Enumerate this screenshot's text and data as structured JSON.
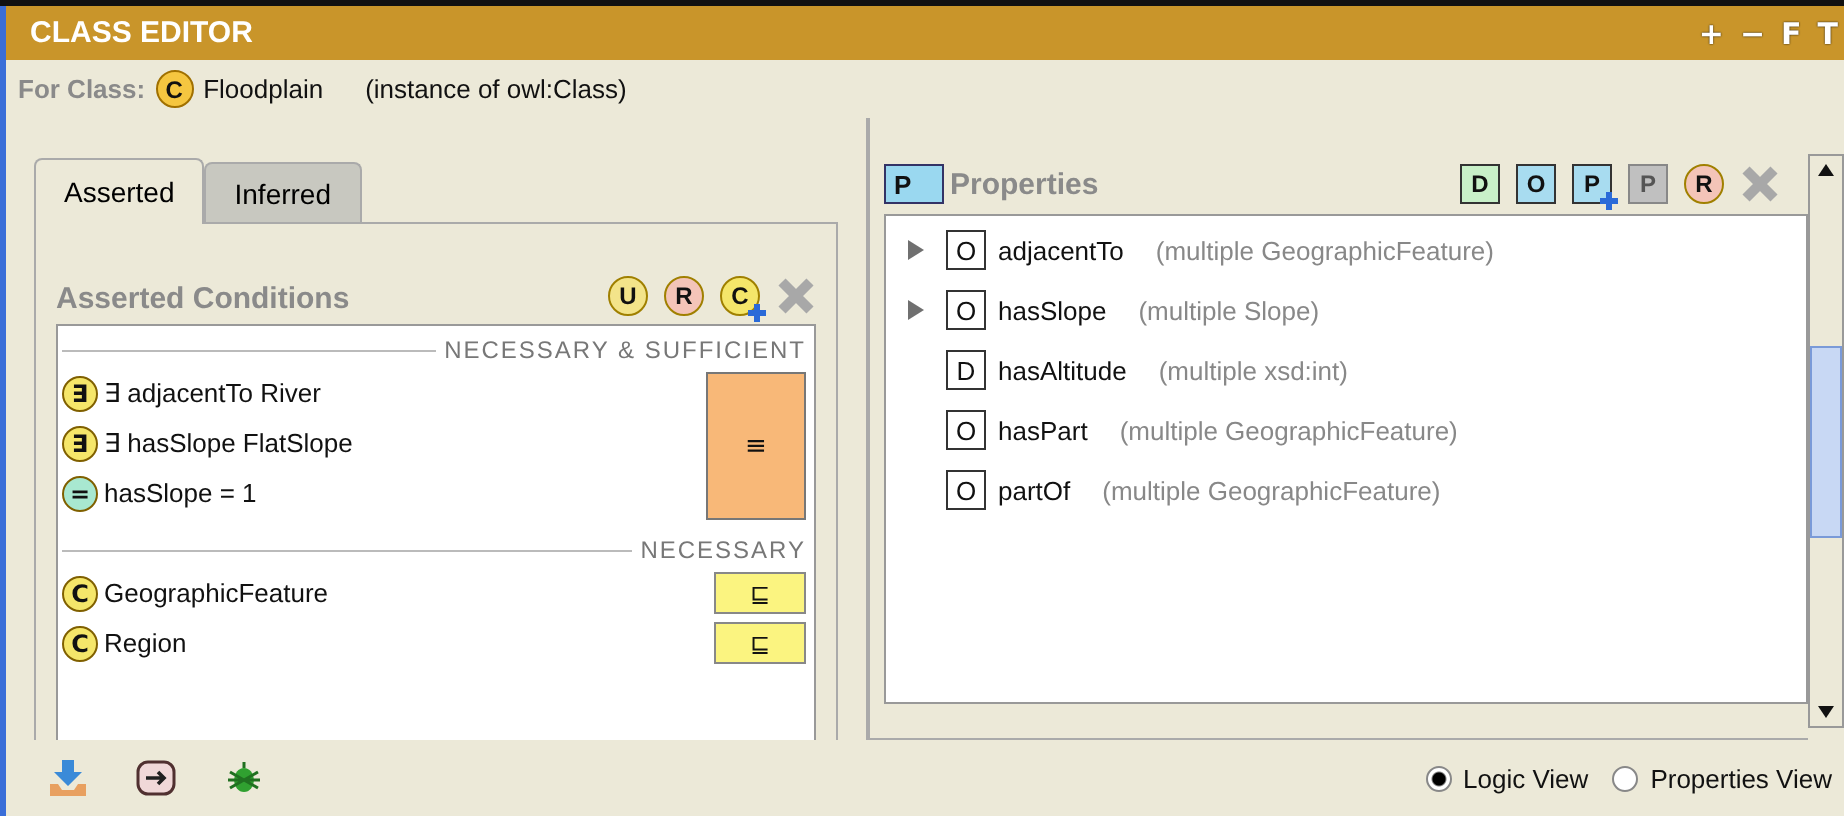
{
  "window": {
    "title": "CLASS EDITOR",
    "title_buttons": [
      "+",
      "−",
      "F",
      "T"
    ]
  },
  "for_class": {
    "label": "For Class:",
    "icon_glyph": "C",
    "name": "Floodplain",
    "type": "(instance of owl:Class)"
  },
  "tabs": [
    {
      "label": "Asserted",
      "selected": true
    },
    {
      "label": "Inferred",
      "selected": false
    }
  ],
  "conditions": {
    "title": "Asserted Conditions",
    "toolbar": [
      {
        "kind": "circle",
        "glyph": "U",
        "color": "#f3e48a",
        "disabled": false,
        "plus": false
      },
      {
        "kind": "circle",
        "glyph": "R",
        "color": "#f4c4b8",
        "disabled": false,
        "plus": false
      },
      {
        "kind": "circle",
        "glyph": "C",
        "color": "#f5e66a",
        "disabled": false,
        "plus": true
      },
      {
        "kind": "delete",
        "disabled": true
      }
    ],
    "sections": [
      {
        "heading": "NECESSARY & SUFFICIENT",
        "kind": "defined",
        "marker": "≡",
        "items": [
          {
            "glyph": "∃",
            "color": "#f5e66a",
            "text": "∃ adjacentTo River"
          },
          {
            "glyph": "∃",
            "color": "#f5e66a",
            "text": "∃ hasSlope FlatSlope"
          },
          {
            "glyph": "=",
            "color": "#a8e8d0",
            "text": "hasSlope = 1"
          }
        ]
      },
      {
        "heading": "NECESSARY",
        "kind": "necessary",
        "marker": "⊑",
        "items": [
          {
            "glyph": "C",
            "color": "#f5e66a",
            "text": "GeographicFeature"
          },
          {
            "glyph": "C",
            "color": "#f5e66a",
            "text": "Region"
          }
        ]
      }
    ]
  },
  "properties": {
    "title_glyph": "P",
    "title": "Properties",
    "toolbar": [
      {
        "kind": "square",
        "glyph": "D",
        "color": "#c8f0c8",
        "disabled": false,
        "plus": false
      },
      {
        "kind": "square",
        "glyph": "O",
        "color": "#a8dcf0",
        "disabled": false,
        "plus": false
      },
      {
        "kind": "square",
        "glyph": "P",
        "color": "#a8dcf0",
        "disabled": false,
        "plus": true
      },
      {
        "kind": "square",
        "glyph": "P",
        "color": "#c0c0c0",
        "disabled": true,
        "plus": false
      },
      {
        "kind": "circle",
        "glyph": "R",
        "color": "#f4c4b8",
        "disabled": false,
        "plus": false
      },
      {
        "kind": "delete",
        "disabled": true
      }
    ],
    "items": [
      {
        "glyph": "O",
        "name": "adjacentTo",
        "range": "(multiple GeographicFeature)",
        "expandable": true
      },
      {
        "glyph": "O",
        "name": "hasSlope",
        "range": "(multiple Slope)",
        "expandable": true
      },
      {
        "glyph": "D",
        "name": "hasAltitude",
        "range": "(multiple xsd:int)",
        "expandable": false
      },
      {
        "glyph": "O",
        "name": "hasPart",
        "range": "(multiple GeographicFeature)",
        "expandable": false
      },
      {
        "glyph": "O",
        "name": "partOf",
        "range": "(multiple GeographicFeature)",
        "expandable": false
      }
    ]
  },
  "view_options": [
    {
      "label": "Logic View",
      "selected": true
    },
    {
      "label": "Properties View",
      "selected": false
    }
  ]
}
